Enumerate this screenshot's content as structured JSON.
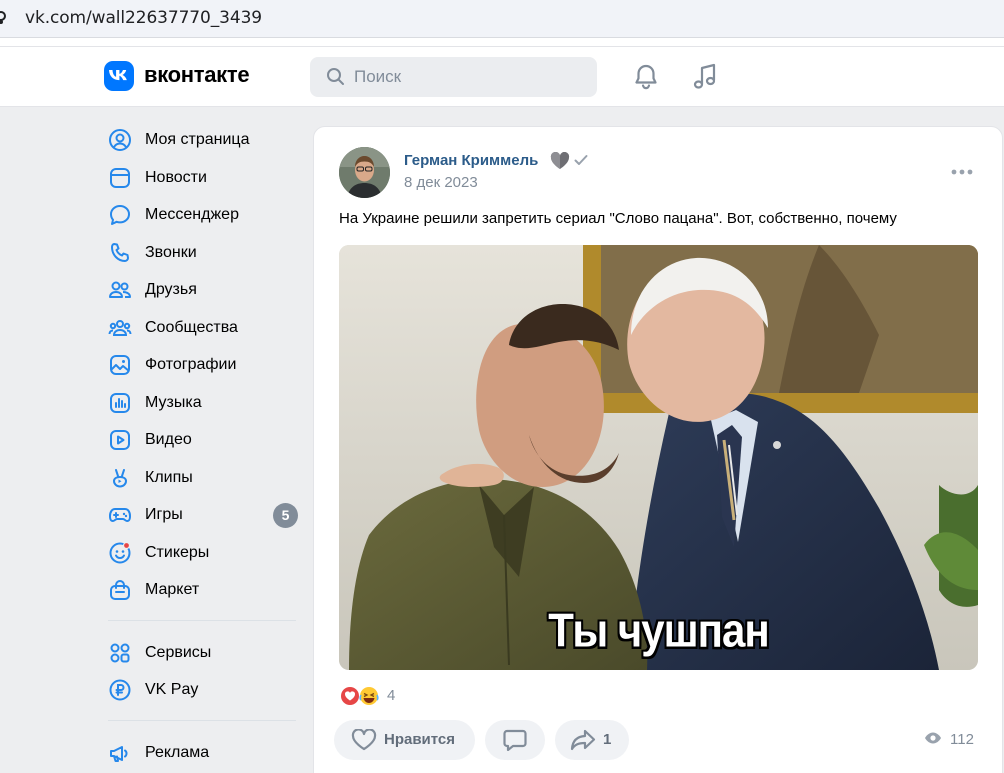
{
  "browser": {
    "url": "vk.com/wall22637770_3439"
  },
  "header": {
    "brand": "вконтакте",
    "search_placeholder": "Поиск",
    "accent": "#0077ff"
  },
  "sidebar": {
    "items": [
      {
        "label": "Моя страница",
        "icon": "user-circle-icon"
      },
      {
        "label": "Новости",
        "icon": "news-icon"
      },
      {
        "label": "Мессенджер",
        "icon": "message-icon"
      },
      {
        "label": "Звонки",
        "icon": "phone-icon"
      },
      {
        "label": "Друзья",
        "icon": "friends-icon"
      },
      {
        "label": "Сообщества",
        "icon": "communities-icon"
      },
      {
        "label": "Фотографии",
        "icon": "photo-icon"
      },
      {
        "label": "Музыка",
        "icon": "music-icon"
      },
      {
        "label": "Видео",
        "icon": "video-icon"
      },
      {
        "label": "Клипы",
        "icon": "clips-icon"
      },
      {
        "label": "Игры",
        "icon": "games-icon",
        "badge": "5"
      },
      {
        "label": "Стикеры",
        "icon": "stickers-icon"
      },
      {
        "label": "Маркет",
        "icon": "market-icon"
      }
    ],
    "secondary": [
      {
        "label": "Сервисы",
        "icon": "services-icon"
      },
      {
        "label": "VK Pay",
        "icon": "vkpay-icon"
      }
    ],
    "tertiary": [
      {
        "label": "Реклама",
        "icon": "ads-icon"
      }
    ]
  },
  "post": {
    "author": "Герман Криммель",
    "date": "8 дек 2023",
    "text": "На Украине решили запретить сериал \"Слово пацана\". Вот, собственно, почему",
    "image_caption": "Ты чушпан",
    "reactions_count": "4",
    "like_label": "Нравится",
    "shares_count": "1",
    "views_count": "112"
  }
}
